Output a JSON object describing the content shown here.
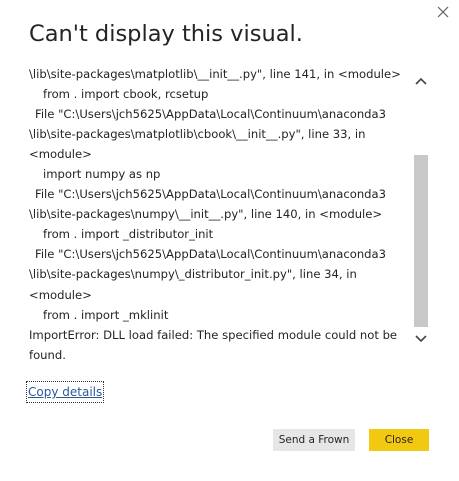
{
  "dialog": {
    "title": "Can't display this visual.",
    "error_lines": [
      {
        "text": "\\lib\\site-packages\\matplotlib\\__init__.py\", line 141, in <module>",
        "indent": 0
      },
      {
        "text": "from . import cbook, rcsetup",
        "indent": 1
      },
      {
        "text": "File \"C:\\Users\\jch5625\\AppData\\Local\\Continuum\\anaconda3",
        "indent": 2
      },
      {
        "text": "\\lib\\site-packages\\matplotlib\\cbook\\__init__.py\", line 33, in",
        "indent": 0
      },
      {
        "text": "<module>",
        "indent": 0
      },
      {
        "text": "import numpy as np",
        "indent": 1
      },
      {
        "text": "File \"C:\\Users\\jch5625\\AppData\\Local\\Continuum\\anaconda3",
        "indent": 2
      },
      {
        "text": "\\lib\\site-packages\\numpy\\__init__.py\", line 140, in <module>",
        "indent": 0
      },
      {
        "text": "from . import _distributor_init",
        "indent": 1
      },
      {
        "text": "File \"C:\\Users\\jch5625\\AppData\\Local\\Continuum\\anaconda3",
        "indent": 2
      },
      {
        "text": "\\lib\\site-packages\\numpy\\_distributor_init.py\", line 34, in",
        "indent": 0
      },
      {
        "text": "<module>",
        "indent": 0
      },
      {
        "text": "from . import _mklinit",
        "indent": 1
      },
      {
        "text": "ImportError: DLL load failed: The specified module could not be",
        "indent": 0
      },
      {
        "text": "found.",
        "indent": 0
      }
    ],
    "copy_details_label": "Copy details",
    "send_frown_label": "Send a Frown",
    "close_label": "Close"
  },
  "icons": {
    "close": "close-icon",
    "scroll_up": "chevron-up-icon",
    "scroll_down": "chevron-down-icon"
  },
  "colors": {
    "primary_button": "#f2c811",
    "secondary_button": "#e6e6e6",
    "link": "#2b579a",
    "scroll_thumb": "#c8c8c8",
    "text": "#252423"
  }
}
